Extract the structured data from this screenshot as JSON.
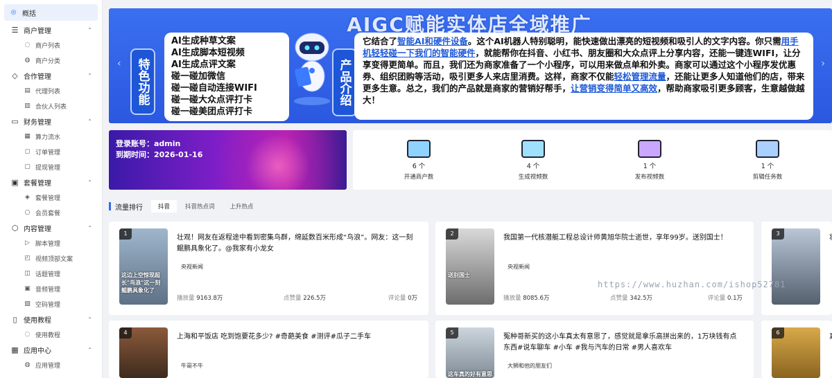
{
  "sidebar": {
    "overview": "概括",
    "groups": [
      {
        "label": "商户管理",
        "icon": "list-icon",
        "items": [
          "商户列表",
          "商户分类"
        ]
      },
      {
        "label": "合作管理",
        "icon": "diamond-icon",
        "items": [
          "代理列表",
          "合伙人列表"
        ]
      },
      {
        "label": "财务管理",
        "icon": "wallet-icon",
        "items": [
          "算力流水",
          "订单管理",
          "提现管理"
        ]
      },
      {
        "label": "套餐管理",
        "icon": "bag-icon",
        "items": [
          "套餐管理",
          "会员套餐"
        ]
      },
      {
        "label": "内容管理",
        "icon": "cube-icon",
        "items": [
          "脚本管理",
          "视频顶部文案",
          "话题管理",
          "音频管理",
          "空码管理"
        ]
      },
      {
        "label": "使用教程",
        "icon": "book-icon",
        "items": [
          "使用教程"
        ]
      },
      {
        "label": "应用中心",
        "icon": "apps-icon",
        "items": [
          "应用管理"
        ]
      }
    ]
  },
  "banner": {
    "title": "AIGC赋能实体店全域推广",
    "feature_tag": "特色功能",
    "features": [
      "AI生成种草文案",
      "AI生成脚本短视频",
      "AI生成点评文案",
      "碰一碰加微信",
      "碰一碰自动连接WIFI",
      "碰一碰大众点评打卡",
      "碰一碰美团点评打卡"
    ],
    "product_tag": "产品介绍",
    "product_segments": [
      {
        "t": "它结合了",
        "h": false
      },
      {
        "t": "智能AI和硬件设备",
        "h": true
      },
      {
        "t": "。这个AI机器人特别聪明，能快速做出漂亮的短视频和吸引人的文字内容。你只需",
        "h": false
      },
      {
        "t": "用手机轻轻碰一下我们的智能硬件",
        "h": true
      },
      {
        "t": "，就能帮你在抖音、小红书、朋友圈和大众点评上分享内容，还能一键连WIFI，让分享变得更简单。而且，我们还为商家准备了一个小程序，可以用来做点单和外卖。商家可以通过这个小程序发优惠券、组织团购等活动，吸引更多人来店里消费。这样，商家不仅能",
        "h": false
      },
      {
        "t": "轻松管理流量",
        "h": true
      },
      {
        "t": "，还能让更多人知道他们的店，带来更多生意。总之，我们的产品就是商家的营销好帮手，",
        "h": false
      },
      {
        "t": "让营销变得简单又高效",
        "h": true
      },
      {
        "t": "，帮助商家吸引更多顾客，生意越做越大！",
        "h": false
      }
    ]
  },
  "login": {
    "account": "登录账号：admin",
    "time": "到期时间：2026-01-16"
  },
  "stats": [
    {
      "num": "6 个",
      "label": "开通商户数",
      "icon": "merchant-icon"
    },
    {
      "num": "4 个",
      "label": "生成视频数",
      "icon": "video-folder-icon"
    },
    {
      "num": "1 个",
      "label": "发布视频数",
      "icon": "publish-icon"
    },
    {
      "num": "1 个",
      "label": "剪辑任务数",
      "icon": "edit-task-icon"
    }
  ],
  "traffic": {
    "title": "流量排行",
    "tabs": [
      "抖音",
      "抖音热点词",
      "上升热点"
    ],
    "metric_labels": {
      "play": "播放量",
      "like": "点赞量",
      "comment": "评论量"
    },
    "cards": [
      {
        "rank": "1",
        "title": "壮观！网友在返程途中看到密集鸟群，绵延数百米形成“鸟浪”。网友：这一刻鲲鹏具象化了。@我家有小龙女",
        "source": "央视新闻",
        "play": "9163.8万",
        "like": "226.5万",
        "comment": "0万"
      },
      {
        "rank": "2",
        "title": "我国第一代核潜艇工程总设计师黄旭华院士逝世，享年99岁。送别国士！",
        "source": "央视新闻",
        "play": "8085.6万",
        "like": "342.5万",
        "comment": "0.1万"
      },
      {
        "rank": "3",
        "title": "壮",
        "source": "",
        "play": "",
        "like": "",
        "comment": ""
      },
      {
        "rank": "4",
        "title": "上海和平饭店 吃到饱要花多少? #奇葩美食 #测评#瓜子二手车",
        "source": "牛哥不牛",
        "play": "",
        "like": "",
        "comment": ""
      },
      {
        "rank": "5",
        "title": "冤种哥新买的这小车真太有意思了，感觉就是拿乐高拼出来的，1万块钱有点东西#说车聊车 #小车 #我与汽车的日常 #男人喜欢车",
        "source": "大狮和他的朋友们",
        "play": "",
        "like": "",
        "comment": ""
      },
      {
        "rank": "6",
        "title": "真",
        "source": "",
        "play": "",
        "like": "",
        "comment": ""
      }
    ],
    "thumb_captions": {
      "c1": "这边上空惊现超长\"鸟浪\"这一刻鲲鹏具象化了",
      "c2": "送别国士",
      "c5": "这车真的好有意思"
    }
  },
  "watermark": "https://www.huzhan.com/ishop52781",
  "colors": {
    "accent": "#2f6bea",
    "banner": "#2b58e0",
    "highlight": "#1e5ad8"
  }
}
